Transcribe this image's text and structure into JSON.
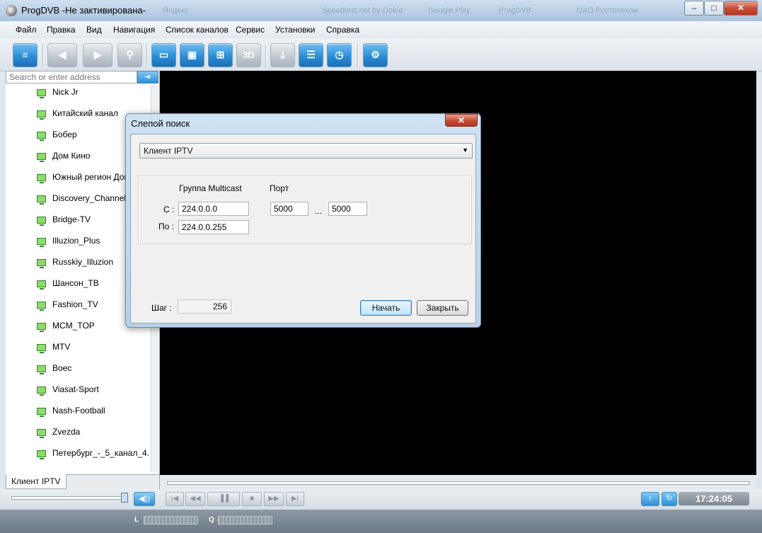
{
  "window": {
    "title": "ProgDVB -Не зактивирована-",
    "background_tabs": [
      "Яндекс",
      "Speedtest.net by Ookla",
      "Google Play",
      "ProgDVB",
      "ОАО Ростелеком"
    ],
    "controls": {
      "minimize": "–",
      "maximize": "□",
      "close": "✕"
    }
  },
  "menu": [
    "Файл",
    "Правка",
    "Вид",
    "Навигация",
    "Список каналов",
    "Сервис",
    "Установки",
    "Справка"
  ],
  "toolbar": {
    "buttons": [
      {
        "icon": "channel-list-icon",
        "glyph": "≡"
      },
      {
        "icon": "back-arrow-icon",
        "glyph": "◀"
      },
      {
        "icon": "forward-arrow-icon",
        "glyph": "▶"
      },
      {
        "icon": "search-icon",
        "glyph": "⚲"
      },
      {
        "icon": "single-window-icon",
        "glyph": "▭"
      },
      {
        "icon": "multi-window-icon",
        "glyph": "▣"
      },
      {
        "icon": "grid-icon",
        "glyph": "⊞"
      },
      {
        "icon": "3d-icon",
        "glyph": "3D"
      },
      {
        "icon": "record-icon",
        "glyph": "⤓"
      },
      {
        "icon": "epg-list-icon",
        "glyph": "☰"
      },
      {
        "icon": "scheduler-clock-icon",
        "glyph": "◷"
      },
      {
        "icon": "settings-gear-icon",
        "glyph": "⚙"
      }
    ]
  },
  "sidebar": {
    "search_placeholder": "Search or enter address",
    "search_go": "➔",
    "channels": [
      "Nick Jr",
      "Китайский канал",
      "Бобер",
      "Дом Кино",
      "Южный регион Дон",
      "Discovery_Channel",
      "Bridge-TV",
      "Illuzion_Plus",
      "Russkiy_Illuzion",
      "Шансон_ТВ",
      "Fashion_TV",
      "MCM_TOP",
      "MTV",
      "Boec",
      "Viasat-Sport",
      "Nash-Football",
      "Zvezda",
      "Петербург_-_5_канал_4..."
    ],
    "tab_label": "Клиент IPTV"
  },
  "player": {
    "clock": "17:24:05",
    "buttons": [
      "|◀",
      "◀◀",
      "▐▐",
      "■",
      "▶▶",
      "▶|"
    ],
    "mute": "◀))",
    "eq": "↕",
    "loop": "↻",
    "levels": [
      {
        "label": "L"
      },
      {
        "label": "Q"
      }
    ]
  },
  "dialog": {
    "title": "Слепой поиск",
    "close": "✕",
    "mode_selected": "Клиент IPTV",
    "group_header": "Группа Multicast",
    "port_header": "Порт",
    "from_label": "С :",
    "to_label": "По :",
    "from_address": "224.0.0.0",
    "to_address": "224.0.0.255",
    "port_from": "5000",
    "port_separator": "...",
    "port_to": "5000",
    "step_label": "Шаг :",
    "step_value": "256",
    "start_button": "Начать",
    "close_button": "Закрыть"
  }
}
